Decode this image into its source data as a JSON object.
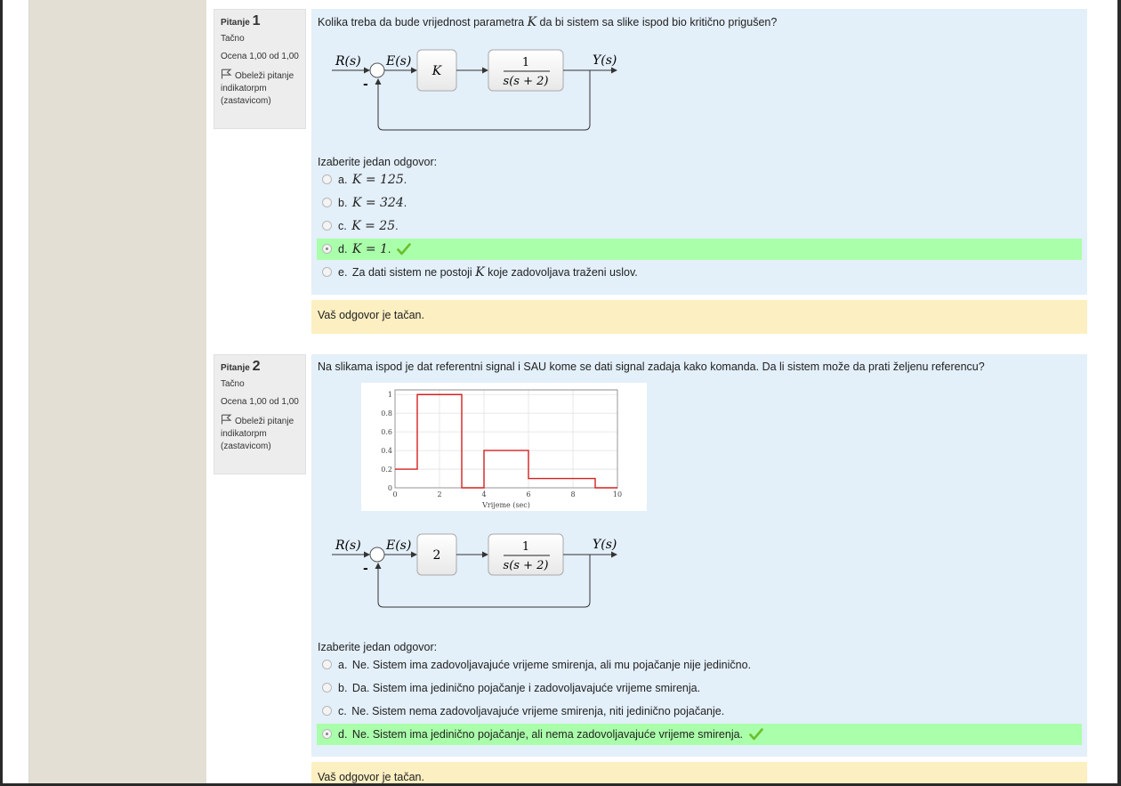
{
  "questions": [
    {
      "pitanje_label": "Pitanje",
      "number": "1",
      "status": "Tačno",
      "grade": "Ocena 1,00 od 1,00",
      "flag_label": "Obeleži pitanje indikatorpm (zastavicom)",
      "text_before": "Kolika treba da bude vrijednost parametra ",
      "text_var": "K",
      "text_after": " da bi sistem sa slike ispod bio kritično prigušen?",
      "diagram": {
        "input": "R(s)",
        "error": "E(s)",
        "gain": "K",
        "plant_num": "1",
        "plant_den": "s(s + 2)",
        "output": "Y(s)",
        "minus": "-"
      },
      "prompt": "Izaberite jedan odgovor:",
      "answers": [
        {
          "letter": "a.",
          "math": "K = 125",
          "suffix": ".",
          "selected": false,
          "correct": false
        },
        {
          "letter": "b.",
          "math": "K = 324",
          "suffix": ".",
          "selected": false,
          "correct": false
        },
        {
          "letter": "c.",
          "math": "K = 25",
          "suffix": ".",
          "selected": false,
          "correct": false
        },
        {
          "letter": "d.",
          "math": "K = 1",
          "suffix": ".",
          "selected": true,
          "correct": true
        },
        {
          "letter": "e.",
          "pre": "Za dati sistem ne postoji ",
          "var": "K",
          "post": " koje zadovoljava traženi uslov.",
          "selected": false,
          "correct": false
        }
      ],
      "feedback": "Vaš odgovor je tačan."
    },
    {
      "pitanje_label": "Pitanje",
      "number": "2",
      "status": "Tačno",
      "grade": "Ocena 1,00 od 1,00",
      "flag_label": "Obeleži pitanje indikatorpm (zastavicom)",
      "text": "Na slikama ispod je dat referentni signal i SAU kome se dati signal zadaja kako komanda. Da li sistem može da prati željenu referencu?",
      "diagram": {
        "input": "R(s)",
        "error": "E(s)",
        "gain": "2",
        "plant_num": "1",
        "plant_den": "s(s + 2)",
        "output": "Y(s)",
        "minus": "-"
      },
      "prompt": "Izaberite jedan odgovor:",
      "answers": [
        {
          "letter": "a.",
          "text": "Ne. Sistem ima zadovoljavajuće vrijeme smirenja, ali mu pojačanje nije jedinično.",
          "selected": false,
          "correct": false
        },
        {
          "letter": "b.",
          "text": "Da. Sistem ima jedinično pojačanje i zadovoljavajuće vrijeme smirenja.",
          "selected": false,
          "correct": false
        },
        {
          "letter": "c.",
          "text": "Ne. Sistem nema zadovoljavajuće vrijeme smirenja, niti jedinično pojačanje.",
          "selected": false,
          "correct": false
        },
        {
          "letter": "d.",
          "text": "Ne. Sistem ima jedinično pojačanje, ali nema zadovoljavajuće vrijeme smirenja.",
          "selected": true,
          "correct": true
        }
      ],
      "feedback": "Vaš odgovor je tačan."
    }
  ],
  "chart_data": {
    "type": "line",
    "step": true,
    "xlabel": "Vrijeme (sec)",
    "ylabel": "",
    "title": "",
    "xlim": [
      0,
      10
    ],
    "ylim": [
      0,
      1.05
    ],
    "xticks": [
      "0",
      "2",
      "4",
      "6",
      "8",
      "10"
    ],
    "yticks": [
      "0",
      "0.2",
      "0.4",
      "0.6",
      "0.8",
      "1"
    ],
    "grid": true,
    "series": [
      {
        "color": "#d42020",
        "x": [
          0,
          1,
          1,
          3,
          3,
          4,
          4,
          6,
          6,
          9,
          9,
          10
        ],
        "y": [
          0.2,
          0.2,
          1,
          1,
          0,
          0,
          0.4,
          0.4,
          0.1,
          0.1,
          0,
          0
        ]
      }
    ]
  },
  "colors": {
    "correct_bg": "#aaffaa",
    "question_bg": "#e3eff9",
    "feedback_bg": "#fcefc1",
    "info_bg": "#ededed",
    "check": "#6cbf2a"
  }
}
